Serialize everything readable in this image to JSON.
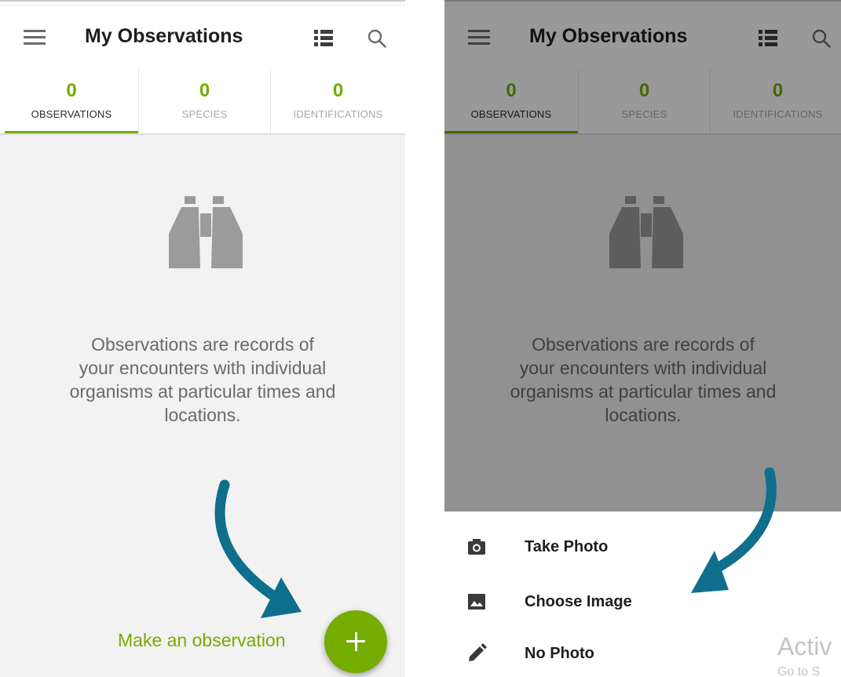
{
  "app": {
    "title": "My Observations"
  },
  "tabs": [
    {
      "count": "0",
      "label": "OBSERVATIONS"
    },
    {
      "count": "0",
      "label": "SPECIES"
    },
    {
      "count": "0",
      "label": "IDENTIFICATIONS"
    }
  ],
  "empty_state": {
    "message_lines": [
      "Observations are records of",
      "your encounters with individual",
      "organisms at particular times and",
      "locations."
    ]
  },
  "cta": {
    "label": "Make an observation"
  },
  "sheet": {
    "items": [
      {
        "label": "Take Photo",
        "icon": "camera-icon"
      },
      {
        "label": "Choose Image",
        "icon": "image-icon"
      },
      {
        "label": "No Photo",
        "icon": "pencil-icon"
      }
    ]
  },
  "watermark": {
    "line1": "Activ",
    "line2": "Go to S"
  },
  "colors": {
    "accent": "#74ac00",
    "arrow": "#0f6f8c",
    "overlay": "rgba(0,0,0,0.40)"
  },
  "icons": {
    "menu": "hamburger-menu-icon",
    "list": "list-view-icon",
    "search": "search-icon",
    "empty": "binoculars-icon",
    "fab": "plus-icon"
  }
}
